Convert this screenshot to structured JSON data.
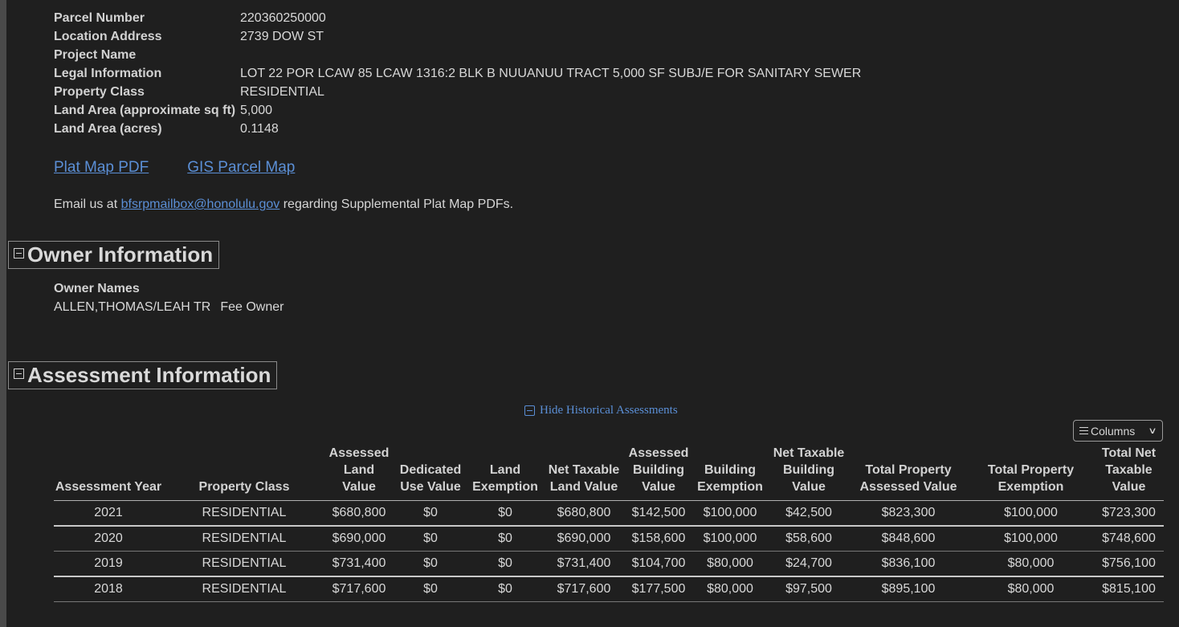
{
  "parcel": {
    "rows": [
      {
        "label": "Parcel Number",
        "value": "220360250000"
      },
      {
        "label": "Location Address",
        "value": "2739 DOW ST"
      },
      {
        "label": "Project Name",
        "value": ""
      },
      {
        "label": "Legal Information",
        "value": "LOT 22 POR LCAW 85 LCAW 1316:2 BLK B NUUANUU TRACT 5,000 SF SUBJ/E FOR SANITARY SEWER"
      },
      {
        "label": "Property Class",
        "value": "RESIDENTIAL"
      },
      {
        "label": "Land Area (approximate sq ft)",
        "value": "5,000"
      },
      {
        "label": "Land Area (acres)",
        "value": "0.1148"
      }
    ]
  },
  "links": {
    "plat_map": "Plat Map PDF",
    "gis_map": "GIS Parcel Map"
  },
  "email": {
    "prefix": "Email us at ",
    "address": "bfsrpmailbox@honolulu.gov",
    "suffix": " regarding Supplemental Plat Map PDFs."
  },
  "owner": {
    "title": "Owner Information",
    "label": "Owner Names",
    "name": "ALLEN,THOMAS/LEAH TR",
    "type": "Fee Owner"
  },
  "assessment": {
    "title": "Assessment Information",
    "hide_historical": "Hide Historical Assessments",
    "columns_button": "Columns",
    "headers": [
      "Assessment Year",
      "Property Class",
      "Assessed Land Value",
      "Dedicated Use Value",
      "Land Exemption",
      "Net Taxable Land Value",
      "Assessed Building Value",
      "Building Exemption",
      "Net Taxable Building Value",
      "Total Property Assessed Value",
      "Total Property Exemption",
      "Total Net Taxable Value"
    ],
    "rows": [
      [
        "2021",
        "RESIDENTIAL",
        "$680,800",
        "$0",
        "$0",
        "$680,800",
        "$142,500",
        "$100,000",
        "$42,500",
        "$823,300",
        "$100,000",
        "$723,300"
      ],
      [
        "2020",
        "RESIDENTIAL",
        "$690,000",
        "$0",
        "$0",
        "$690,000",
        "$158,600",
        "$100,000",
        "$58,600",
        "$848,600",
        "$100,000",
        "$748,600"
      ],
      [
        "2019",
        "RESIDENTIAL",
        "$731,400",
        "$0",
        "$0",
        "$731,400",
        "$104,700",
        "$80,000",
        "$24,700",
        "$836,100",
        "$80,000",
        "$756,100"
      ],
      [
        "2018",
        "RESIDENTIAL",
        "$717,600",
        "$0",
        "$0",
        "$717,600",
        "$177,500",
        "$80,000",
        "$97,500",
        "$895,100",
        "$80,000",
        "$815,100"
      ]
    ]
  }
}
